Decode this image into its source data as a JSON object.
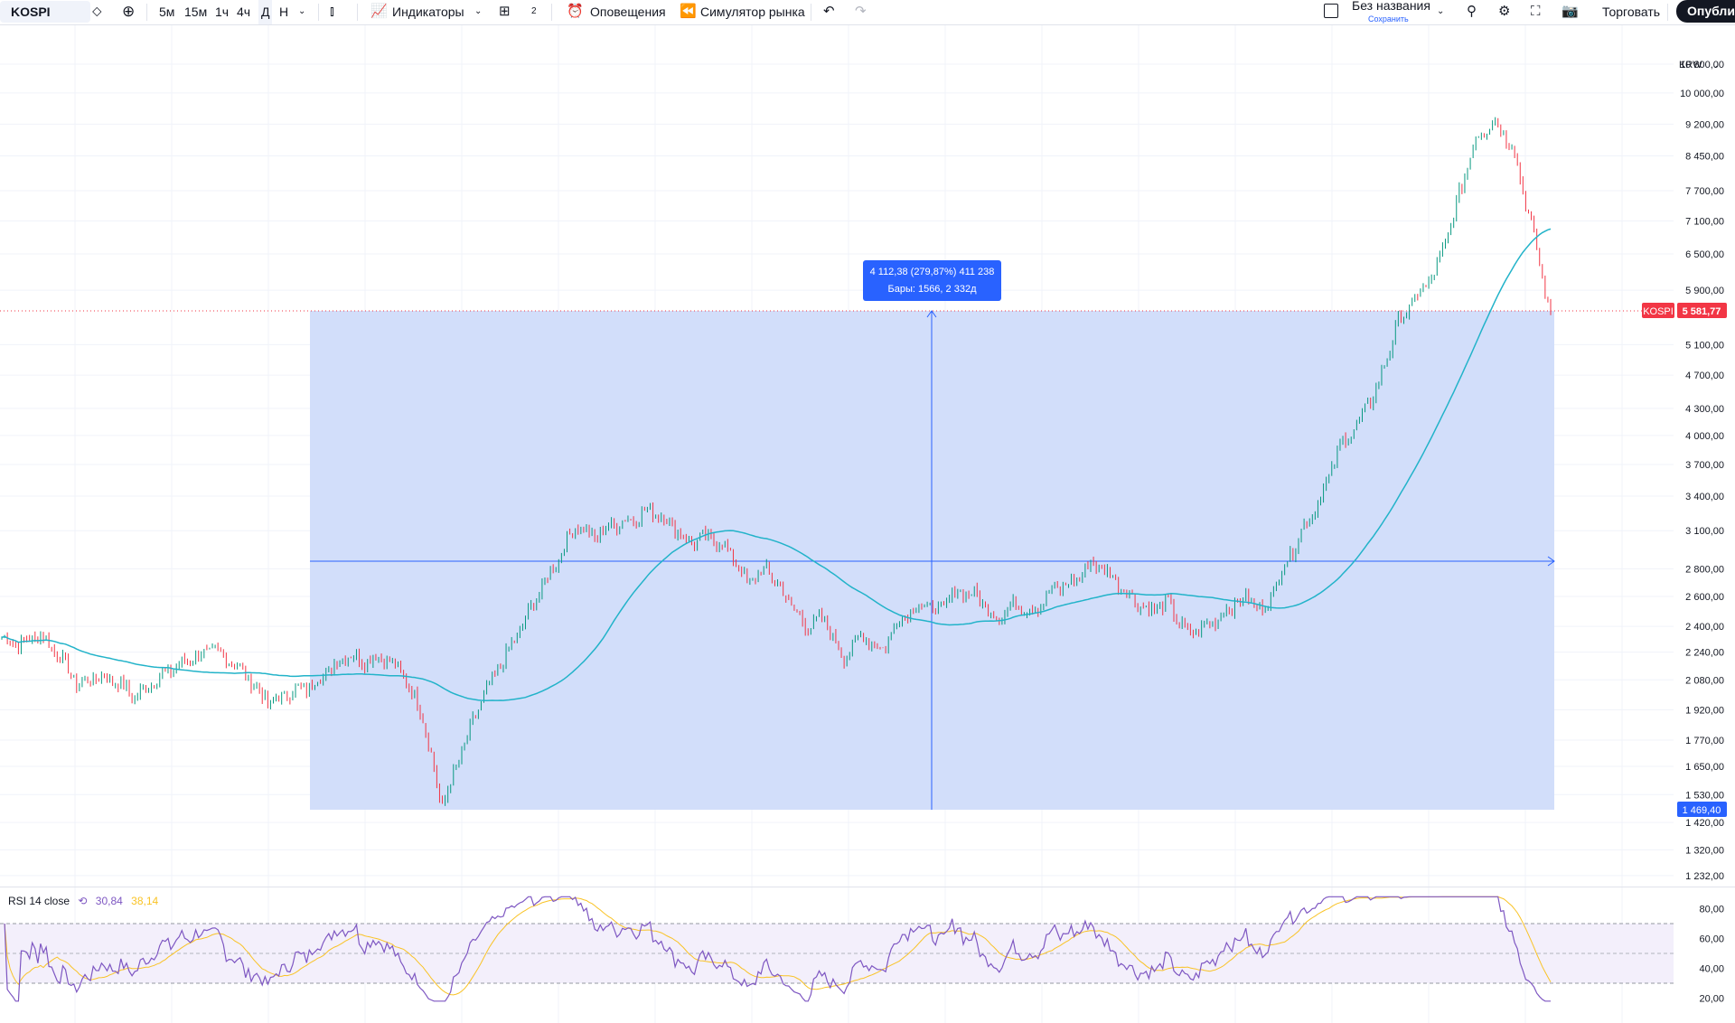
{
  "toolbar": {
    "symbol": "KOSPI",
    "intervals": [
      "5м",
      "15м",
      "1ч",
      "4ч",
      "Д",
      "Н"
    ],
    "indicators_label": "Индикаторы",
    "layouts_count": "2",
    "alerts_label": "Оповещения",
    "replay_label": "Симулятор рынка",
    "layout_name": "Без названия",
    "save_label": "Сохранить",
    "trade_label": "Торговать",
    "publish_label": "Опубликовать"
  },
  "price_axis": {
    "currency": "KRW",
    "ticks": [
      "10 800,00",
      "10 000,00",
      "9 200,00",
      "8 450,00",
      "7 700,00",
      "7 100,00",
      "6 500,00",
      "5 900,00",
      "5 100,00",
      "4 700,00",
      "4 300,00",
      "4 000,00",
      "3 700,00",
      "3 400,00",
      "3 100,00",
      "2 800,00",
      "2 600,00",
      "2 400,00",
      "2 240,00",
      "2 080,00",
      "1 920,00",
      "1 770,00",
      "1 650,00",
      "1 530,00",
      "1 420,00",
      "1 320,00",
      "1 232,00"
    ],
    "current_label": "KOSPI",
    "current_price": "5 581,77",
    "measure_low": "1 469,40"
  },
  "measure_tool": {
    "line1": "4 112,38 (279,87%) 411 238",
    "line2": "Бары: 1566, 2 332д"
  },
  "rsi": {
    "title": "RSI 14 close",
    "value1": "30,84",
    "value2": "38,14",
    "ticks": [
      "80,00",
      "60,00",
      "40,00",
      "20,00"
    ]
  },
  "colors": {
    "up": "#089981",
    "down": "#f23645",
    "ma": "#22b3c9",
    "measure_fill": "#d0dcfa",
    "measure_line": "#2962ff",
    "rsi_line": "#7e57c2",
    "rsi_ma": "#f9c326"
  },
  "chart_data": {
    "type": "line",
    "series": [
      {
        "values": [
          2330,
          2290,
          2350,
          2220,
          2050,
          2100,
          2070,
          1990,
          2080,
          2140,
          2210,
          2250,
          2190,
          2080,
          1950,
          2010,
          2040,
          2120,
          2230,
          2190,
          2220,
          2100,
          1900,
          1480,
          1700,
          1950,
          2150,
          2350,
          2600,
          2850,
          3150,
          3050,
          3150,
          3200,
          3280,
          3150,
          3000,
          3050,
          2950,
          2700,
          2800,
          2600,
          2400,
          2450,
          2200,
          2350,
          2250,
          2450,
          2550,
          2500,
          2650,
          2600,
          2450,
          2550,
          2500,
          2650,
          2700,
          2850,
          2750,
          2600,
          2500,
          2550,
          2350,
          2400,
          2500,
          2600,
          2500,
          2800,
          3100,
          3400,
          3900,
          4150,
          4600,
          5400,
          5800,
          6200,
          7300,
          8800,
          9300,
          8700,
          7000,
          5500
        ]
      }
    ]
  }
}
